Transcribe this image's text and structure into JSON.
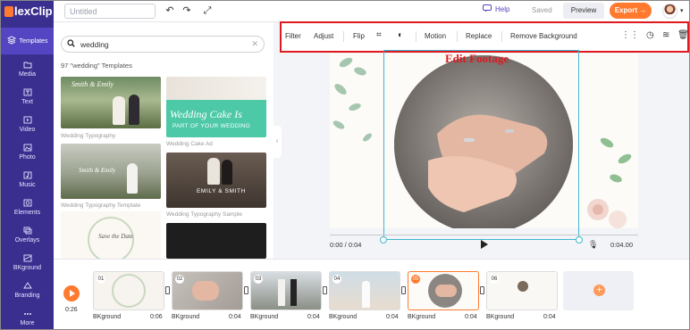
{
  "app": {
    "logo_text": "lexClip"
  },
  "nav": {
    "items": [
      {
        "label": "Templates",
        "icon": "layers-icon"
      },
      {
        "label": "Media",
        "icon": "folder-icon"
      },
      {
        "label": "Text",
        "icon": "text-icon"
      },
      {
        "label": "Video",
        "icon": "video-icon"
      },
      {
        "label": "Photo",
        "icon": "photo-icon"
      },
      {
        "label": "Music",
        "icon": "music-icon"
      },
      {
        "label": "Elements",
        "icon": "elements-icon"
      },
      {
        "label": "Overlays",
        "icon": "overlays-icon"
      },
      {
        "label": "BKground",
        "icon": "background-icon"
      },
      {
        "label": "Branding",
        "icon": "branding-icon"
      },
      {
        "label": "More",
        "icon": "more-icon"
      }
    ]
  },
  "topbar": {
    "title_placeholder": "Untitled",
    "help_label": "Help",
    "saved_label": "Saved",
    "preview_label": "Preview",
    "export_label": "Export →"
  },
  "panel": {
    "search_value": "wedding",
    "count_text": "97 \"wedding\" Templates",
    "templates": [
      {
        "label": "Wedding Typography",
        "overlay": "Smith & Emily"
      },
      {
        "label": "Wedding Cake Ad",
        "overlay": "Wedding Cake Is",
        "overlay2": "PART OF YOUR WEDDING"
      },
      {
        "label": "Wedding Typography Template",
        "overlay": "Smith & Emily"
      },
      {
        "label": "Wedding Typography Sample",
        "overlay": "EMILY & SMITH"
      },
      {
        "label": "",
        "overlay": "Save the Date"
      },
      {
        "label": "",
        "overlay": ""
      }
    ]
  },
  "toolbar": {
    "items": [
      "Filter",
      "Adjust",
      "Flip",
      "Motion",
      "Replace",
      "Remove Background"
    ]
  },
  "annotation": {
    "edit_footage": "Edit Footage"
  },
  "player": {
    "current_time": "0:00 / 0:04",
    "end_time": "0:04.00"
  },
  "timeline": {
    "total_time": "0:26",
    "clips": [
      {
        "num": "01",
        "label": "BKground",
        "duration": "0:06"
      },
      {
        "num": "02",
        "label": "BKground",
        "duration": "0:04"
      },
      {
        "num": "03",
        "label": "BKground",
        "duration": "0:04"
      },
      {
        "num": "04",
        "label": "BKground",
        "duration": "0:04"
      },
      {
        "num": "05",
        "label": "BKground",
        "duration": "0:04"
      },
      {
        "num": "06",
        "label": "BKground",
        "duration": "0:04"
      }
    ]
  },
  "colors": {
    "nav_bg": "#3a2f8f",
    "accent": "#ff7a2f",
    "highlight": "#e0191e",
    "selection": "#3fb6d1",
    "cake_green": "#4ec9a8"
  }
}
